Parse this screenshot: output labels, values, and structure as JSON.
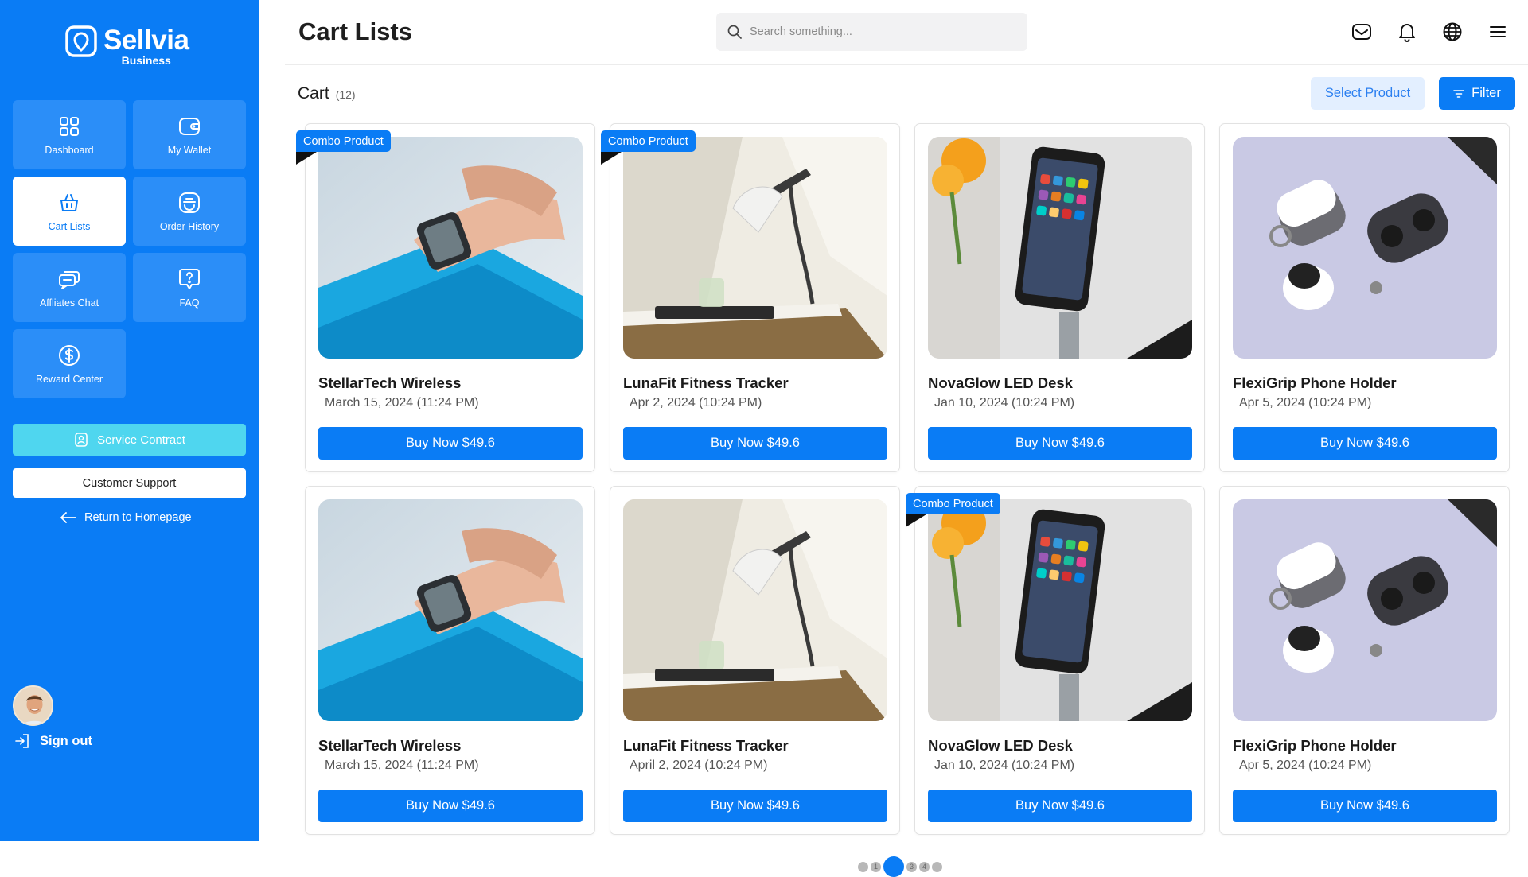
{
  "brand": {
    "name": "Sellvia",
    "subtitle": "Business"
  },
  "sidebar": {
    "tiles": [
      {
        "label": "Dashboard",
        "icon": "grid-icon"
      },
      {
        "label": "My Wallet",
        "icon": "wallet-icon"
      },
      {
        "label": "Cart Lists",
        "icon": "basket-icon",
        "active": true
      },
      {
        "label": "Order History",
        "icon": "order-history-icon"
      },
      {
        "label": "Affliates Chat",
        "icon": "chat-icon"
      },
      {
        "label": "FAQ",
        "icon": "faq-icon"
      },
      {
        "label": "Reward Center",
        "icon": "dollar-icon"
      }
    ],
    "service_contract": "Service Contract",
    "customer_support": "Customer Support",
    "return_home": "Return to Homepage",
    "sign_out": "Sign out"
  },
  "header": {
    "title": "Cart Lists",
    "search_placeholder": "Search something...",
    "icons": [
      "mail-icon",
      "bell-icon",
      "globe-icon",
      "menu-icon"
    ]
  },
  "section": {
    "title": "Cart",
    "count": "(12)",
    "select_label": "Select Product",
    "filter_label": "Filter"
  },
  "products": [
    {
      "name": "StellarTech Wireless",
      "date": "March 15, 2024 (11:24 PM)",
      "button": "Buy Now $49.6",
      "badge": "Combo Product",
      "image": "watch"
    },
    {
      "name": "LunaFit Fitness Tracker",
      "date": "Apr 2, 2024 (10:24 PM)",
      "button": "Buy Now $49.6",
      "badge": "Combo Product",
      "image": "lamp"
    },
    {
      "name": "NovaGlow LED Desk",
      "date": "Jan 10, 2024 (10:24 PM)",
      "button": "Buy Now $49.6",
      "badge": "",
      "image": "phone"
    },
    {
      "name": "FlexiGrip Phone Holder",
      "date": "Apr 5, 2024 (10:24 PM)",
      "button": "Buy Now $49.6",
      "badge": "",
      "image": "earbuds"
    },
    {
      "name": "StellarTech Wireless",
      "date": "March 15, 2024 (11:24 PM)",
      "button": "Buy Now $49.6",
      "badge": "",
      "image": "watch"
    },
    {
      "name": "LunaFit Fitness Tracker",
      "date": "April 2, 2024 (10:24 PM)",
      "button": "Buy Now $49.6",
      "badge": "",
      "image": "lamp"
    },
    {
      "name": "NovaGlow LED Desk",
      "date": "Jan 10, 2024 (10:24 PM)",
      "button": "Buy Now $49.6",
      "badge": "Combo Product",
      "image": "phone"
    },
    {
      "name": "FlexiGrip Phone Holder",
      "date": "Apr 5, 2024 (10:24 PM)",
      "button": "Buy Now $49.6",
      "badge": "",
      "image": "earbuds"
    }
  ],
  "pagination": {
    "pages": [
      "",
      "1",
      "2",
      "3",
      "4",
      ""
    ],
    "current": "2"
  },
  "colors": {
    "primary": "#0a7cf5",
    "sidebar_tile": "#2b8ef8",
    "service": "#4fd6ef",
    "select_bg": "#e3efff"
  }
}
